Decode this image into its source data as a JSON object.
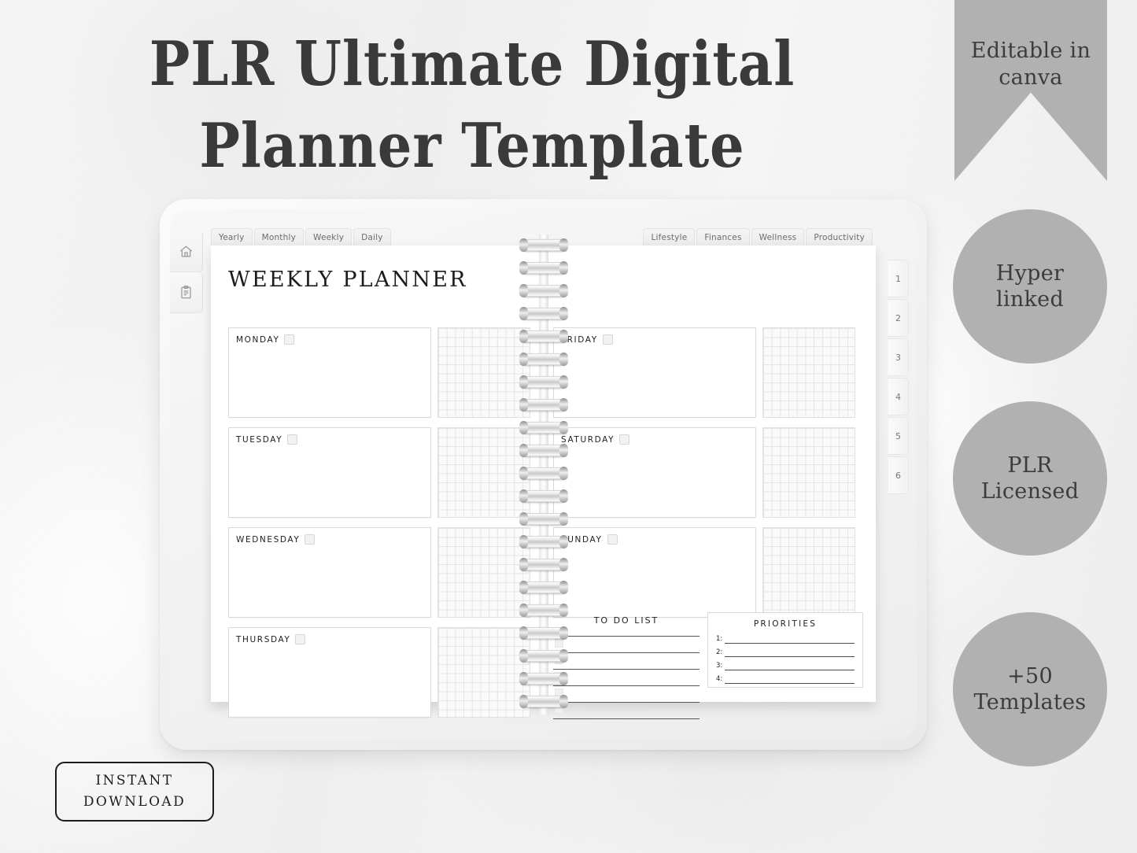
{
  "headline": {
    "line1": "PLR Ultimate Digital",
    "line2": "Planner Template"
  },
  "badges": {
    "banner": {
      "line1": "Editable in",
      "line2": "canva",
      "color": "#b1b1b1"
    },
    "circles": [
      {
        "line1": "Hyper",
        "line2": "linked"
      },
      {
        "line1": "PLR",
        "line2": "Licensed"
      },
      {
        "line1": "+50",
        "line2": "Templates"
      }
    ]
  },
  "instant_download": {
    "line1": "INSTANT",
    "line2": "DOWNLOAD"
  },
  "tablet": {
    "rail_icons": [
      {
        "name": "home-icon"
      },
      {
        "name": "clipboard-icon"
      }
    ],
    "tabs_left": [
      "Yearly",
      "Monthly",
      "Weekly",
      "Daily"
    ],
    "tabs_right": [
      "Lifestyle",
      "Finances",
      "Wellness",
      "Productivity"
    ],
    "page_tabs": [
      "1",
      "2",
      "3",
      "4",
      "5",
      "6"
    ],
    "planner": {
      "title": "WEEKLY PLANNER",
      "days_left": [
        "MONDAY",
        "TUESDAY",
        "WEDNESDAY",
        "THURSDAY"
      ],
      "days_right": [
        "FRIDAY",
        "SATURDAY",
        "SUNDAY"
      ],
      "todo": {
        "heading": "TO DO LIST",
        "rows": 5
      },
      "priorities": {
        "heading": "PRIORITIES",
        "items": [
          "1:",
          "2:",
          "3:",
          "4:"
        ]
      }
    }
  }
}
